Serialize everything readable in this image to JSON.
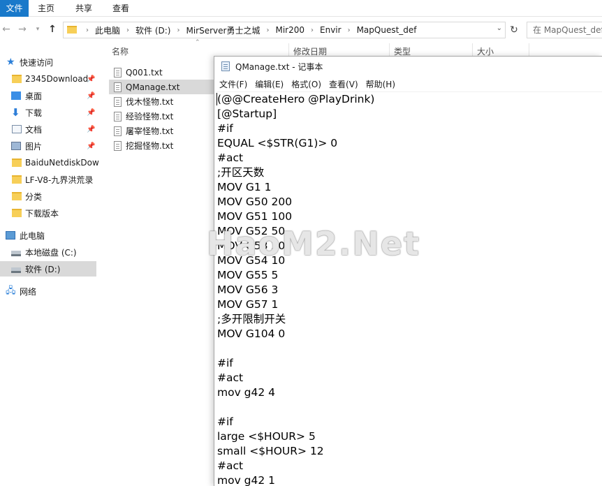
{
  "ribbon": {
    "tabs": [
      "文件",
      "主页",
      "共享",
      "查看"
    ]
  },
  "address": {
    "breadcrumbs": [
      "此电脑",
      "软件 (D:)",
      "MirServer勇士之城",
      "Mir200",
      "Envir",
      "MapQuest_def"
    ],
    "search_placeholder": "在 MapQuest_def"
  },
  "sidebar": {
    "items": [
      {
        "label": "快速访问",
        "icon": "star-icon",
        "pinned": false
      },
      {
        "label": "2345Download",
        "icon": "folder-icon",
        "pinned": true
      },
      {
        "label": "桌面",
        "icon": "desktop-icon",
        "pinned": true
      },
      {
        "label": "下载",
        "icon": "download-icon",
        "pinned": true
      },
      {
        "label": "文档",
        "icon": "document-icon",
        "pinned": true
      },
      {
        "label": "图片",
        "icon": "picture-icon",
        "pinned": true
      },
      {
        "label": "BaiduNetdiskDow",
        "icon": "folder-icon",
        "pinned": false
      },
      {
        "label": "LF-V8-九界洪荒录",
        "icon": "folder-icon",
        "pinned": false
      },
      {
        "label": "分类",
        "icon": "folder-icon",
        "pinned": false
      },
      {
        "label": "下载版本",
        "icon": "folder-icon",
        "pinned": false
      },
      {
        "label": "此电脑",
        "icon": "computer-icon",
        "pinned": false
      },
      {
        "label": "本地磁盘 (C:)",
        "icon": "drive-icon",
        "pinned": false
      },
      {
        "label": "软件 (D:)",
        "icon": "drive-icon",
        "pinned": false,
        "selected": true
      },
      {
        "label": "网络",
        "icon": "network-icon",
        "pinned": false
      }
    ]
  },
  "filelist": {
    "columns": [
      "名称",
      "修改日期",
      "类型",
      "大小"
    ],
    "files": [
      "Q001.txt",
      "QManage.txt",
      "伐木怪物.txt",
      "经验怪物.txt",
      "屠宰怪物.txt",
      "挖掘怪物.txt"
    ],
    "selected_index": 1
  },
  "notepad": {
    "title": "QManage.txt - 记事本",
    "menu": [
      "文件(F)",
      "编辑(E)",
      "格式(O)",
      "查看(V)",
      "帮助(H)"
    ],
    "content": "(@@CreateHero @PlayDrink)\n[@Startup]\n#if\nEQUAL <$STR(G1)> 0\n#act\n;开区天数\nMOV G1 1\nMOV G50 200\nMOV G51 100\nMOV G52 50\nMOV G53 20\nMOV G54 10\nMOV G55 5\nMOV G56 3\nMOV G57 1\n;多开限制开关\nMOV G104 0\n\n#if\n#act\nmov g42 4\n\n#if\nlarge <$HOUR> 5\nsmall <$HOUR> 12\n#act\nmov g42 1"
  },
  "watermark": "HaoM2.Net"
}
